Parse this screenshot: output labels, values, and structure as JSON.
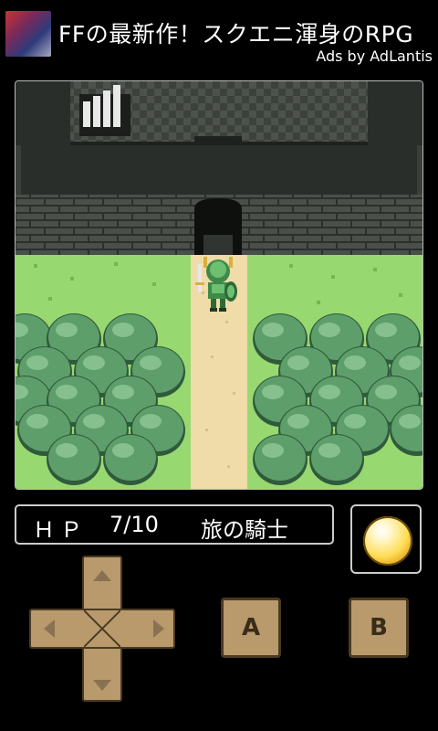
{
  "ad": {
    "headline": "FFの最新作！スクエニ渾身のRPG",
    "attribution": "Ads by AdLantis"
  },
  "status": {
    "hp_label": "ＨＰ",
    "hp_value": "7/10",
    "character_name": "旅の騎士"
  },
  "controls": {
    "a_label": "A",
    "b_label": "B"
  },
  "colors": {
    "grass": "#98d870",
    "path": "#f0dca8",
    "wall": "#4a4f4a",
    "tree": "#5e9e6a",
    "button": "#b89a6c"
  }
}
